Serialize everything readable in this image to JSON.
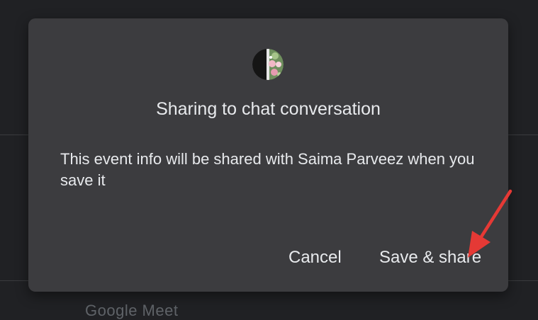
{
  "background": {
    "fragment_text": "Google Meet"
  },
  "dialog": {
    "avatar_icon": "contact-avatar-icon",
    "title": "Sharing to chat conversation",
    "body": "This event info will be shared with Saima Parveez when you save it",
    "cancel_label": "Cancel",
    "save_label": "Save & share"
  },
  "annotation": {
    "arrow_icon": "red-arrow-icon",
    "color": "#e53935"
  },
  "colors": {
    "background": "#202124",
    "dialog": "#3c3c3f",
    "text": "#e8eaed"
  }
}
